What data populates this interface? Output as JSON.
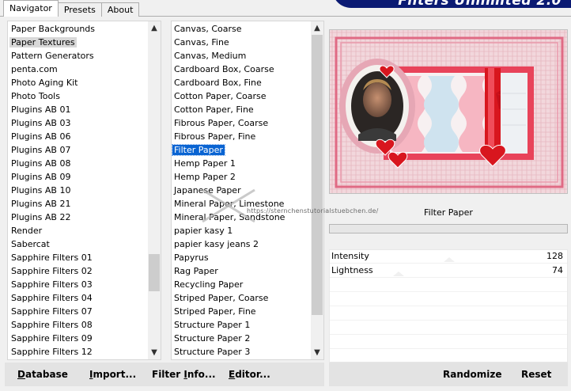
{
  "tabs": [
    "Navigator",
    "Presets",
    "About"
  ],
  "brand": "Filters Unlimited 2.0",
  "categories": [
    "Paper Backgrounds",
    "Paper Textures",
    "Pattern Generators",
    "penta.com",
    "Photo Aging Kit",
    "Photo Tools",
    "Plugins AB 01",
    "Plugins AB 03",
    "Plugins AB 06",
    "Plugins AB 07",
    "Plugins AB 08",
    "Plugins AB 09",
    "Plugins AB 10",
    "Plugins AB 21",
    "Plugins AB 22",
    "Render",
    "Sabercat",
    "Sapphire Filters 01",
    "Sapphire Filters 02",
    "Sapphire Filters 03",
    "Sapphire Filters 04",
    "Sapphire Filters 07",
    "Sapphire Filters 08",
    "Sapphire Filters 09",
    "Sapphire Filters 12"
  ],
  "selected_category": "Paper Textures",
  "filters": [
    "Canvas, Coarse",
    "Canvas, Fine",
    "Canvas, Medium",
    "Cardboard Box, Coarse",
    "Cardboard Box, Fine",
    "Cotton Paper, Coarse",
    "Cotton Paper, Fine",
    "Fibrous Paper, Coarse",
    "Fibrous Paper, Fine",
    "Filter Paper",
    "Hemp Paper 1",
    "Hemp Paper 2",
    "Japanese Paper",
    "Mineral Paper, Limestone",
    "Mineral Paper, Sandstone",
    "papier kasy 1",
    "papier kasy jeans 2",
    "Papyrus",
    "Rag Paper",
    "Recycling Paper",
    "Striped Paper, Coarse",
    "Striped Paper, Fine",
    "Structure Paper 1",
    "Structure Paper 2",
    "Structure Paper 3"
  ],
  "selected_filter": "Filter Paper",
  "preview": {
    "filter_name": "Filter Paper"
  },
  "parameters": [
    {
      "label": "Intensity",
      "value": "128"
    },
    {
      "label": "Lightness",
      "value": "74"
    }
  ],
  "parameter_levels": [
    0.502,
    0.29
  ],
  "buttons": {
    "database": {
      "first": "D",
      "rest": "atabase"
    },
    "import": {
      "first": "I",
      "rest": "mport..."
    },
    "filter_info": {
      "first": "Filter ",
      "ul": "I",
      "rest": "nfo..."
    },
    "editor": {
      "first": "E",
      "rest": "ditor..."
    },
    "randomize": "Randomize",
    "reset": "Reset"
  },
  "watermark": "https://sternchenstutorialstuebchen.de/",
  "colors": {
    "accent": "#0a64d2",
    "brand_bg": "#0b1a73",
    "heart": "#d8161e",
    "frame_red": "#e0202e"
  }
}
